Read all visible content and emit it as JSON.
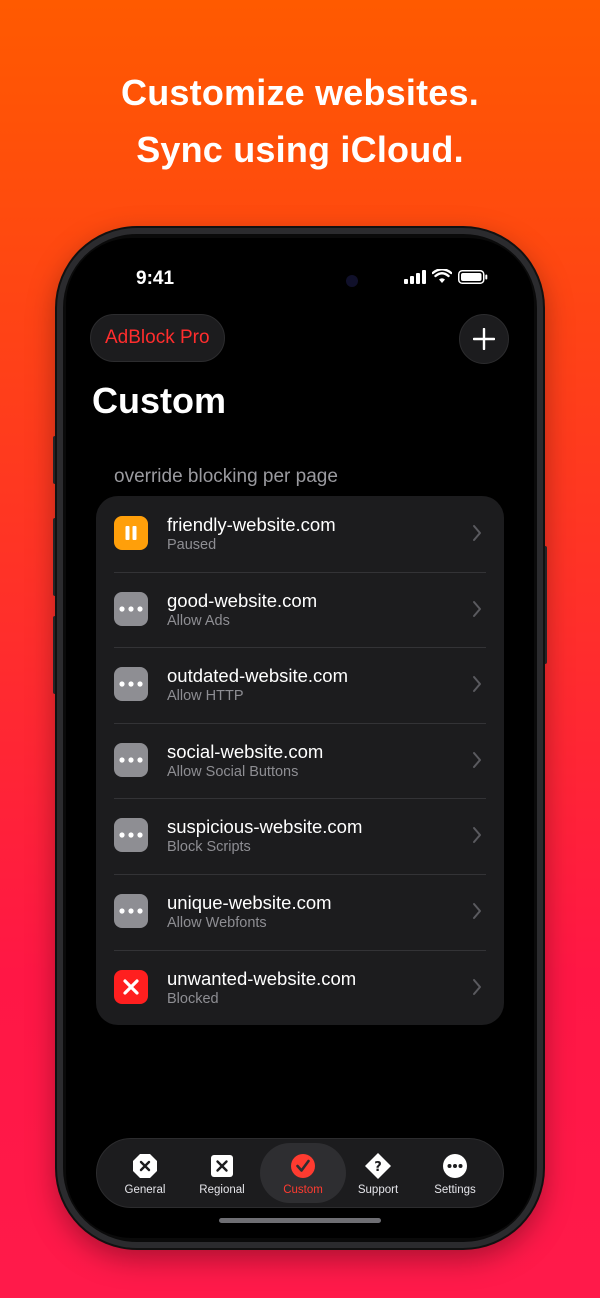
{
  "headline": {
    "line1": "Customize websites.",
    "line2": "Sync using iCloud."
  },
  "status_bar": {
    "time": "9:41",
    "icons": [
      "cellular-signal-icon",
      "wifi-icon",
      "battery-icon"
    ]
  },
  "header": {
    "app_button_label": "AdBlock Pro",
    "add_button_icon": "plus-icon",
    "title": "Custom"
  },
  "section": {
    "header": "override blocking per page"
  },
  "rows": [
    {
      "title": "friendly-website.com",
      "subtitle": "Paused",
      "icon": "pause-icon",
      "icon_color": "#ff9f0a"
    },
    {
      "title": "good-website.com",
      "subtitle": "Allow Ads",
      "icon": "ellipsis-icon",
      "icon_color": "#8e8e93"
    },
    {
      "title": "outdated-website.com",
      "subtitle": "Allow HTTP",
      "icon": "ellipsis-icon",
      "icon_color": "#8e8e93"
    },
    {
      "title": "social-website.com",
      "subtitle": "Allow Social Buttons",
      "icon": "ellipsis-icon",
      "icon_color": "#8e8e93"
    },
    {
      "title": "suspicious-website.com",
      "subtitle": "Block Scripts",
      "icon": "ellipsis-icon",
      "icon_color": "#8e8e93"
    },
    {
      "title": "unique-website.com",
      "subtitle": "Allow Webfonts",
      "icon": "ellipsis-icon",
      "icon_color": "#8e8e93"
    },
    {
      "title": "unwanted-website.com",
      "subtitle": "Blocked",
      "icon": "xmark-icon",
      "icon_color": "#ff1f1f"
    }
  ],
  "tabbar": {
    "tabs": [
      {
        "label": "General",
        "icon": "octagon-x-icon",
        "active": false
      },
      {
        "label": "Regional",
        "icon": "square-x-icon",
        "active": false
      },
      {
        "label": "Custom",
        "icon": "checkmark-circle-icon",
        "active": true
      },
      {
        "label": "Support",
        "icon": "question-diamond-icon",
        "active": false
      },
      {
        "label": "Settings",
        "icon": "ellipsis-circle-icon",
        "active": false
      }
    ]
  },
  "colors": {
    "background_top": "#ff5a00",
    "background_bottom": "#ff1a4a",
    "accent": "#ff3b30",
    "app_button_text": "#ff2d2d"
  }
}
